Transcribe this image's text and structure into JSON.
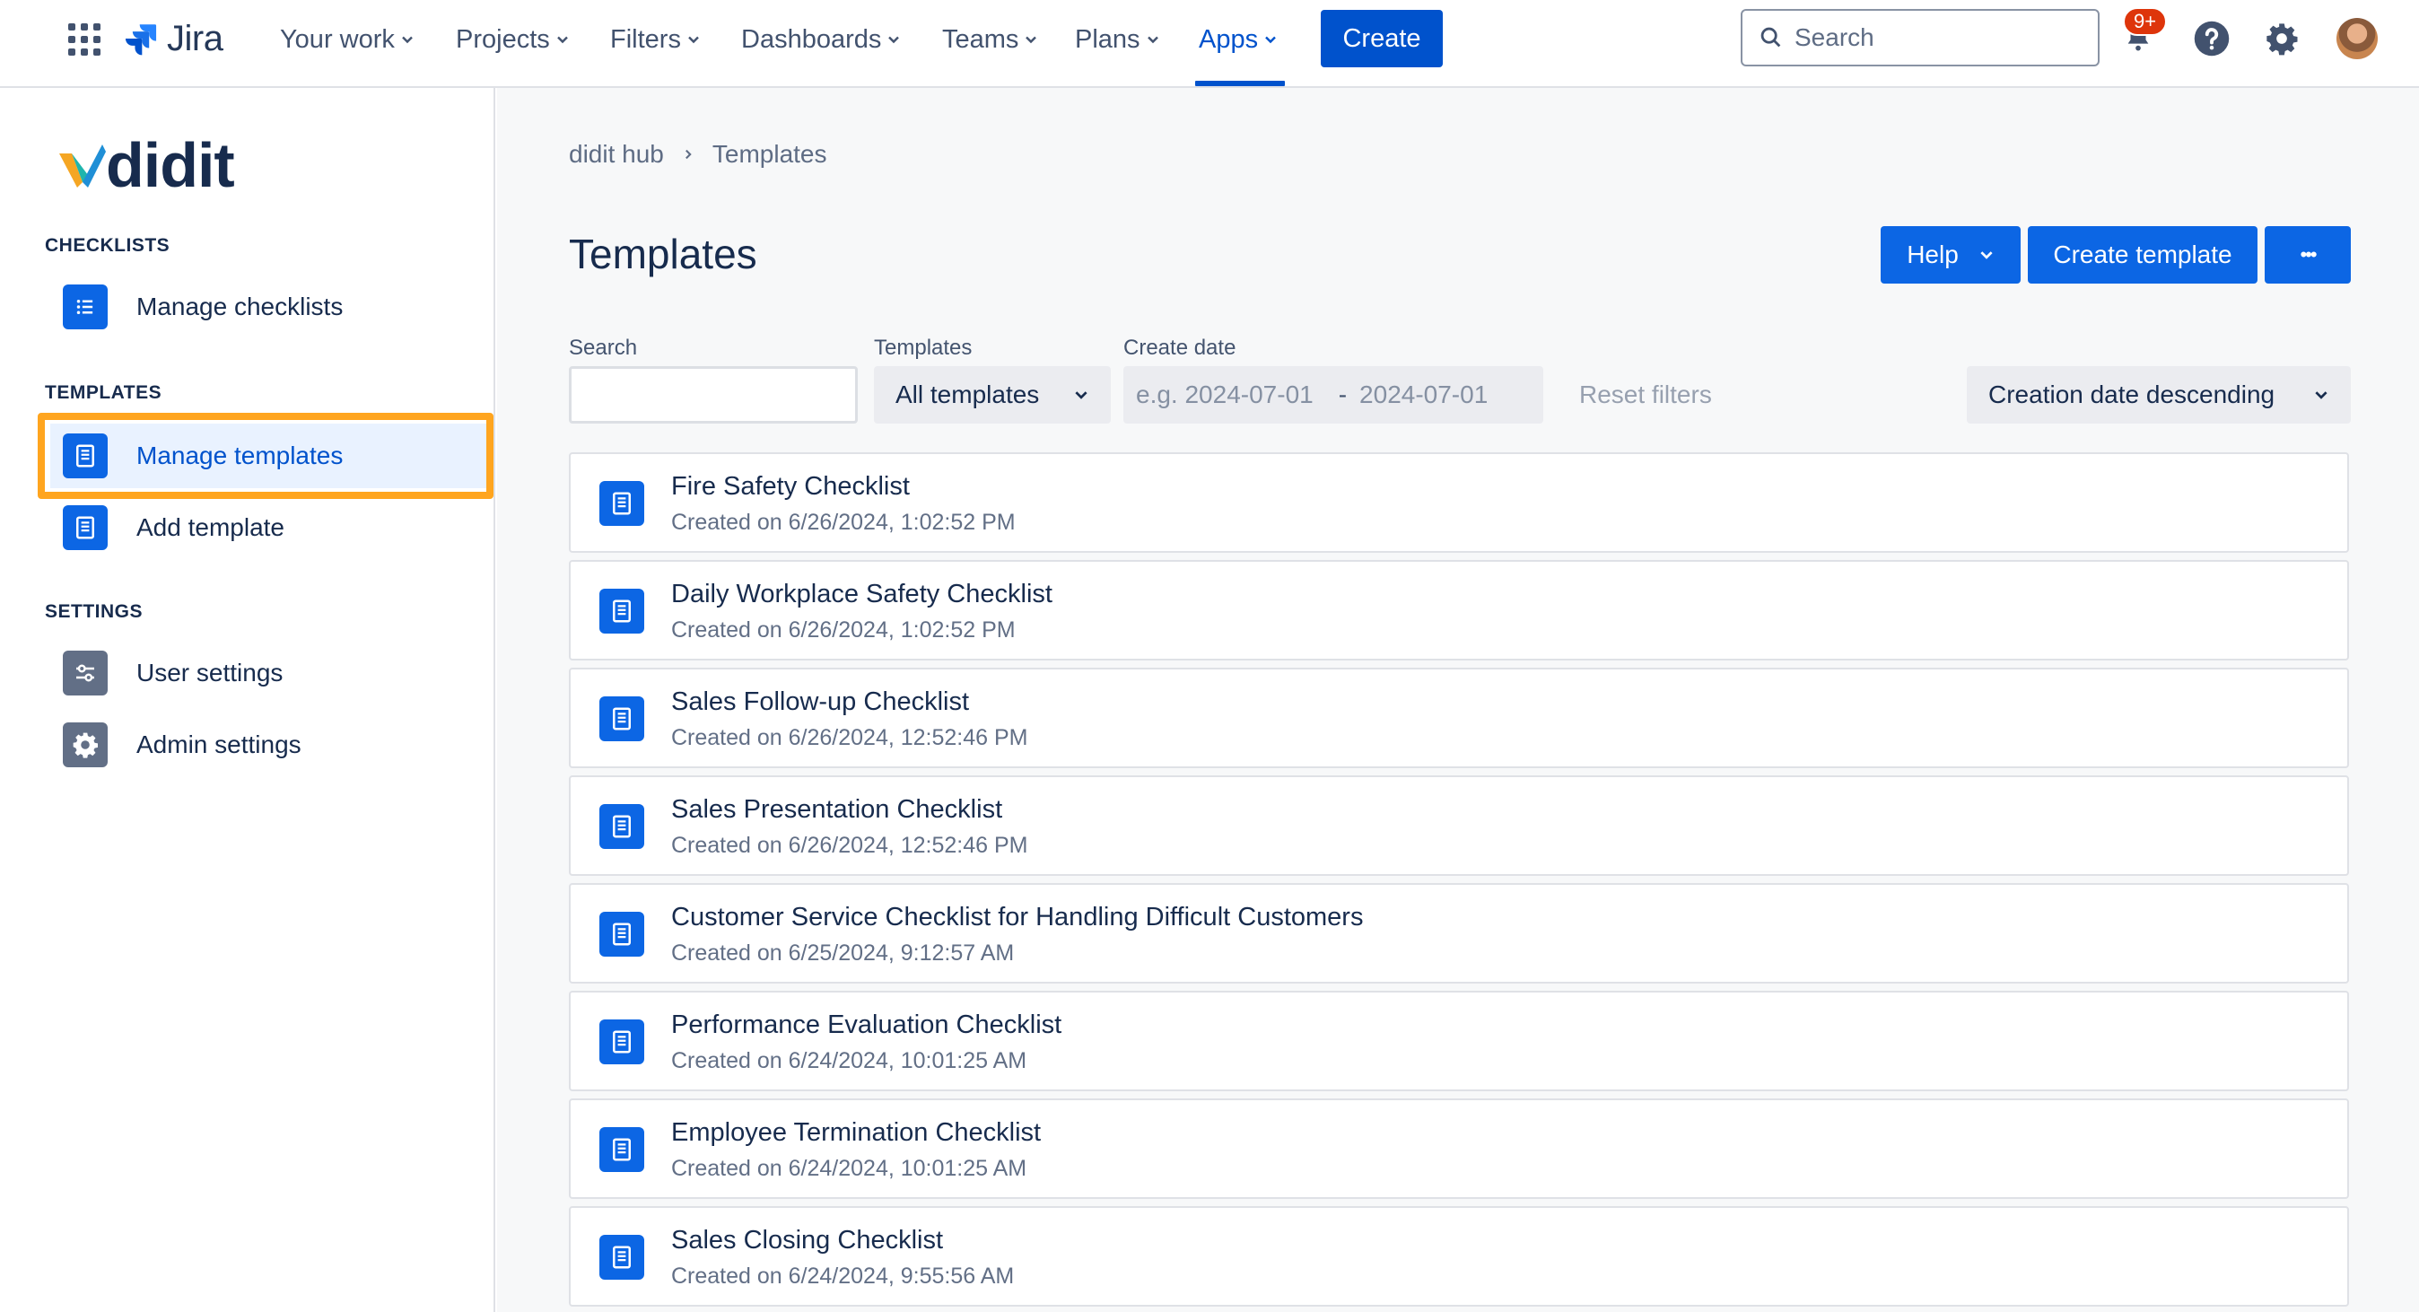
{
  "topnav": {
    "product": "Jira",
    "menus": [
      {
        "label": "Your work"
      },
      {
        "label": "Projects"
      },
      {
        "label": "Filters"
      },
      {
        "label": "Dashboards"
      },
      {
        "label": "Teams"
      },
      {
        "label": "Plans"
      },
      {
        "label": "Apps",
        "active": true
      }
    ],
    "create_label": "Create",
    "search_placeholder": "Search",
    "notifications_badge": "9+"
  },
  "sidebar": {
    "brand": "didit",
    "sections": [
      {
        "title": "CHECKLISTS",
        "items": [
          {
            "label": "Manage checklists",
            "icon": "list-icon"
          }
        ]
      },
      {
        "title": "TEMPLATES",
        "items": [
          {
            "label": "Manage templates",
            "icon": "template-icon",
            "selected": true
          },
          {
            "label": "Add template",
            "icon": "template-icon"
          }
        ]
      },
      {
        "title": "SETTINGS",
        "items": [
          {
            "label": "User settings",
            "icon": "sliders-icon"
          },
          {
            "label": "Admin settings",
            "icon": "gear-icon"
          }
        ]
      }
    ]
  },
  "main": {
    "breadcrumb": [
      "didit hub",
      "Templates"
    ],
    "title": "Templates",
    "buttons": {
      "help": "Help",
      "create_template": "Create template",
      "more": "•••"
    },
    "filters": {
      "search_label": "Search",
      "templates_label": "Templates",
      "templates_value": "All templates",
      "create_date_label": "Create date",
      "date_from_placeholder": "e.g. 2024-07-01",
      "date_separator": "-",
      "date_to_placeholder": "2024-07-01",
      "reset": "Reset filters",
      "sort": "Creation date descending"
    },
    "templates": [
      {
        "name": "Fire Safety Checklist",
        "created": "Created on 6/26/2024, 1:02:52 PM"
      },
      {
        "name": "Daily Workplace Safety Checklist",
        "created": "Created on 6/26/2024, 1:02:52 PM"
      },
      {
        "name": "Sales Follow-up Checklist",
        "created": "Created on 6/26/2024, 12:52:46 PM"
      },
      {
        "name": "Sales Presentation Checklist",
        "created": "Created on 6/26/2024, 12:52:46 PM"
      },
      {
        "name": "Customer Service Checklist for Handling Difficult Customers",
        "created": "Created on 6/25/2024, 9:12:57 AM"
      },
      {
        "name": "Performance Evaluation Checklist",
        "created": "Created on 6/24/2024, 10:01:25 AM"
      },
      {
        "name": "Employee Termination Checklist",
        "created": "Created on 6/24/2024, 10:01:25 AM"
      },
      {
        "name": "Sales Closing Checklist",
        "created": "Created on 6/24/2024, 9:55:56 AM"
      }
    ]
  },
  "colors": {
    "primary": "#0052cc",
    "button": "#0c66e4",
    "highlight": "#ffa51f",
    "badge": "#de350b"
  }
}
